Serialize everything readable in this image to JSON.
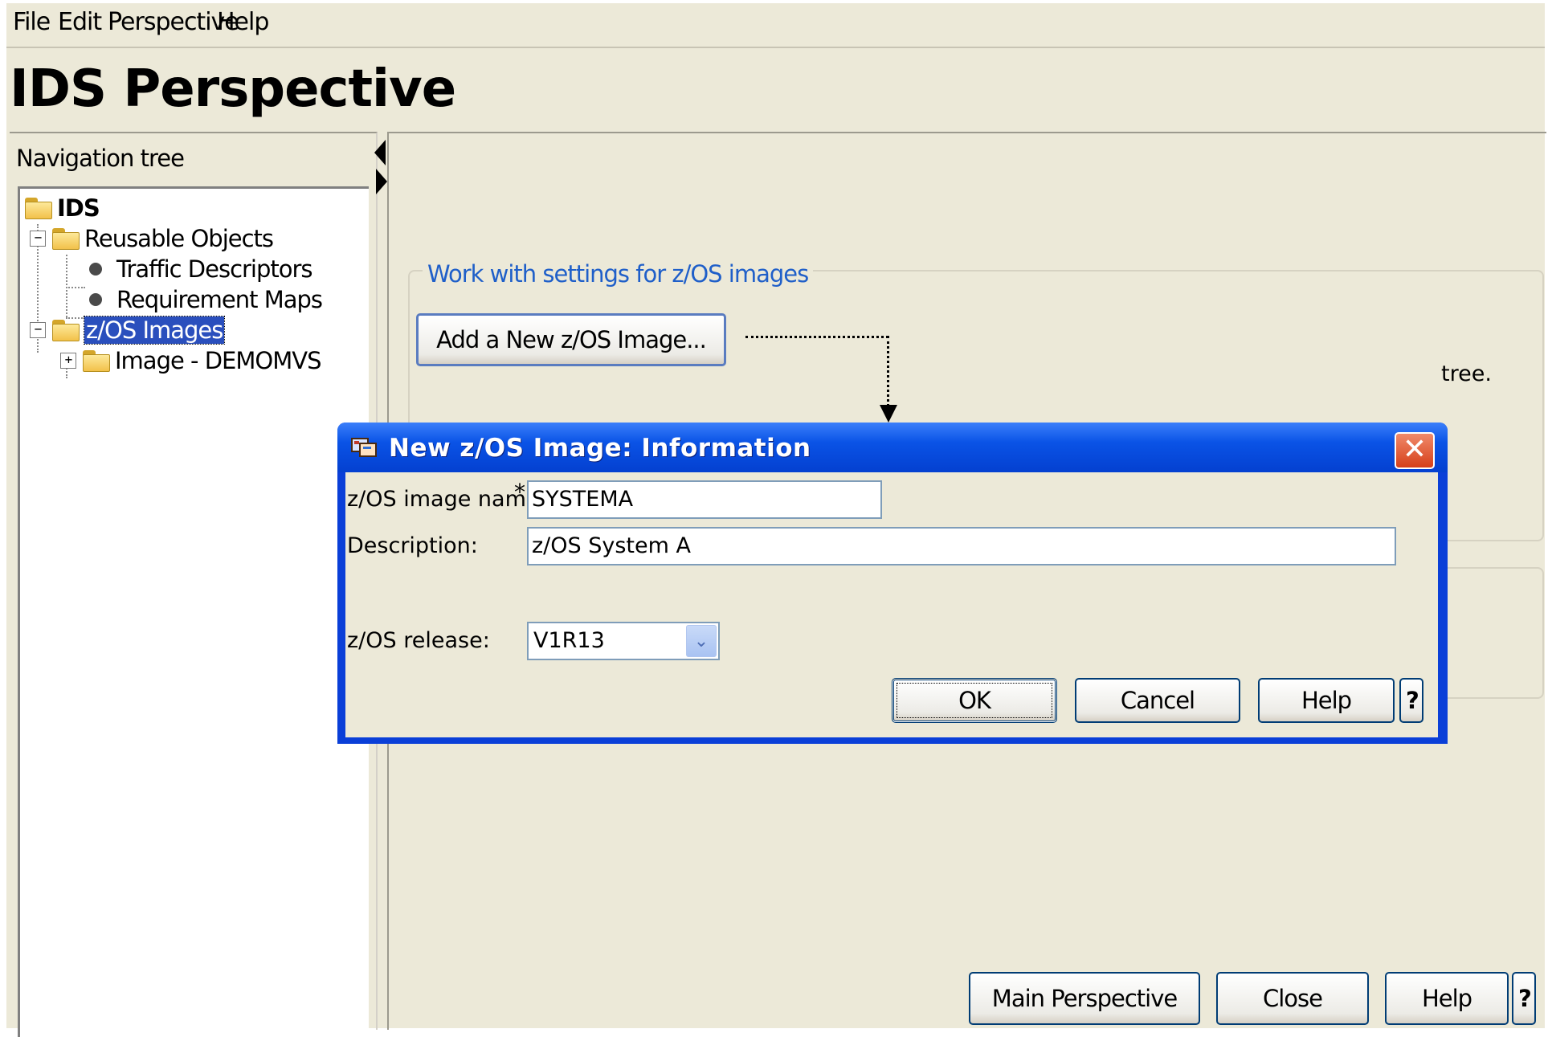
{
  "menu": {
    "items": [
      "File",
      "Edit",
      "Perspective",
      "Help"
    ]
  },
  "page_title": "IDS Perspective",
  "nav": {
    "label": "Navigation tree",
    "tree": {
      "root": "IDS",
      "reusable_objects": "Reusable Objects",
      "traffic_descriptors": "Traffic Descriptors",
      "requirement_maps": "Requirement Maps",
      "zos_images": "z/OS Images",
      "image_demomvs": "Image - DEMOMVS"
    }
  },
  "content": {
    "group_title": "Work with settings for z/OS images",
    "add_button": "Add a New z/OS Image...",
    "partial_text": "tree.",
    "footer": {
      "main_perspective": "Main Perspective",
      "close": "Close",
      "help": "Help",
      "help_icon": "?"
    }
  },
  "dialog": {
    "title": "New z/OS Image: Information",
    "close_glyph": "✕",
    "image_name_label": "z/OS image name:",
    "required_marker": "*",
    "image_name_value": "SYSTEMA",
    "description_label": "Description:",
    "description_value": "z/OS System A",
    "release_label": "z/OS release:",
    "release_value": "V1R13",
    "dropdown_glyph": "⌄",
    "ok": "OK",
    "cancel": "Cancel",
    "help": "Help",
    "help_icon": "?"
  }
}
